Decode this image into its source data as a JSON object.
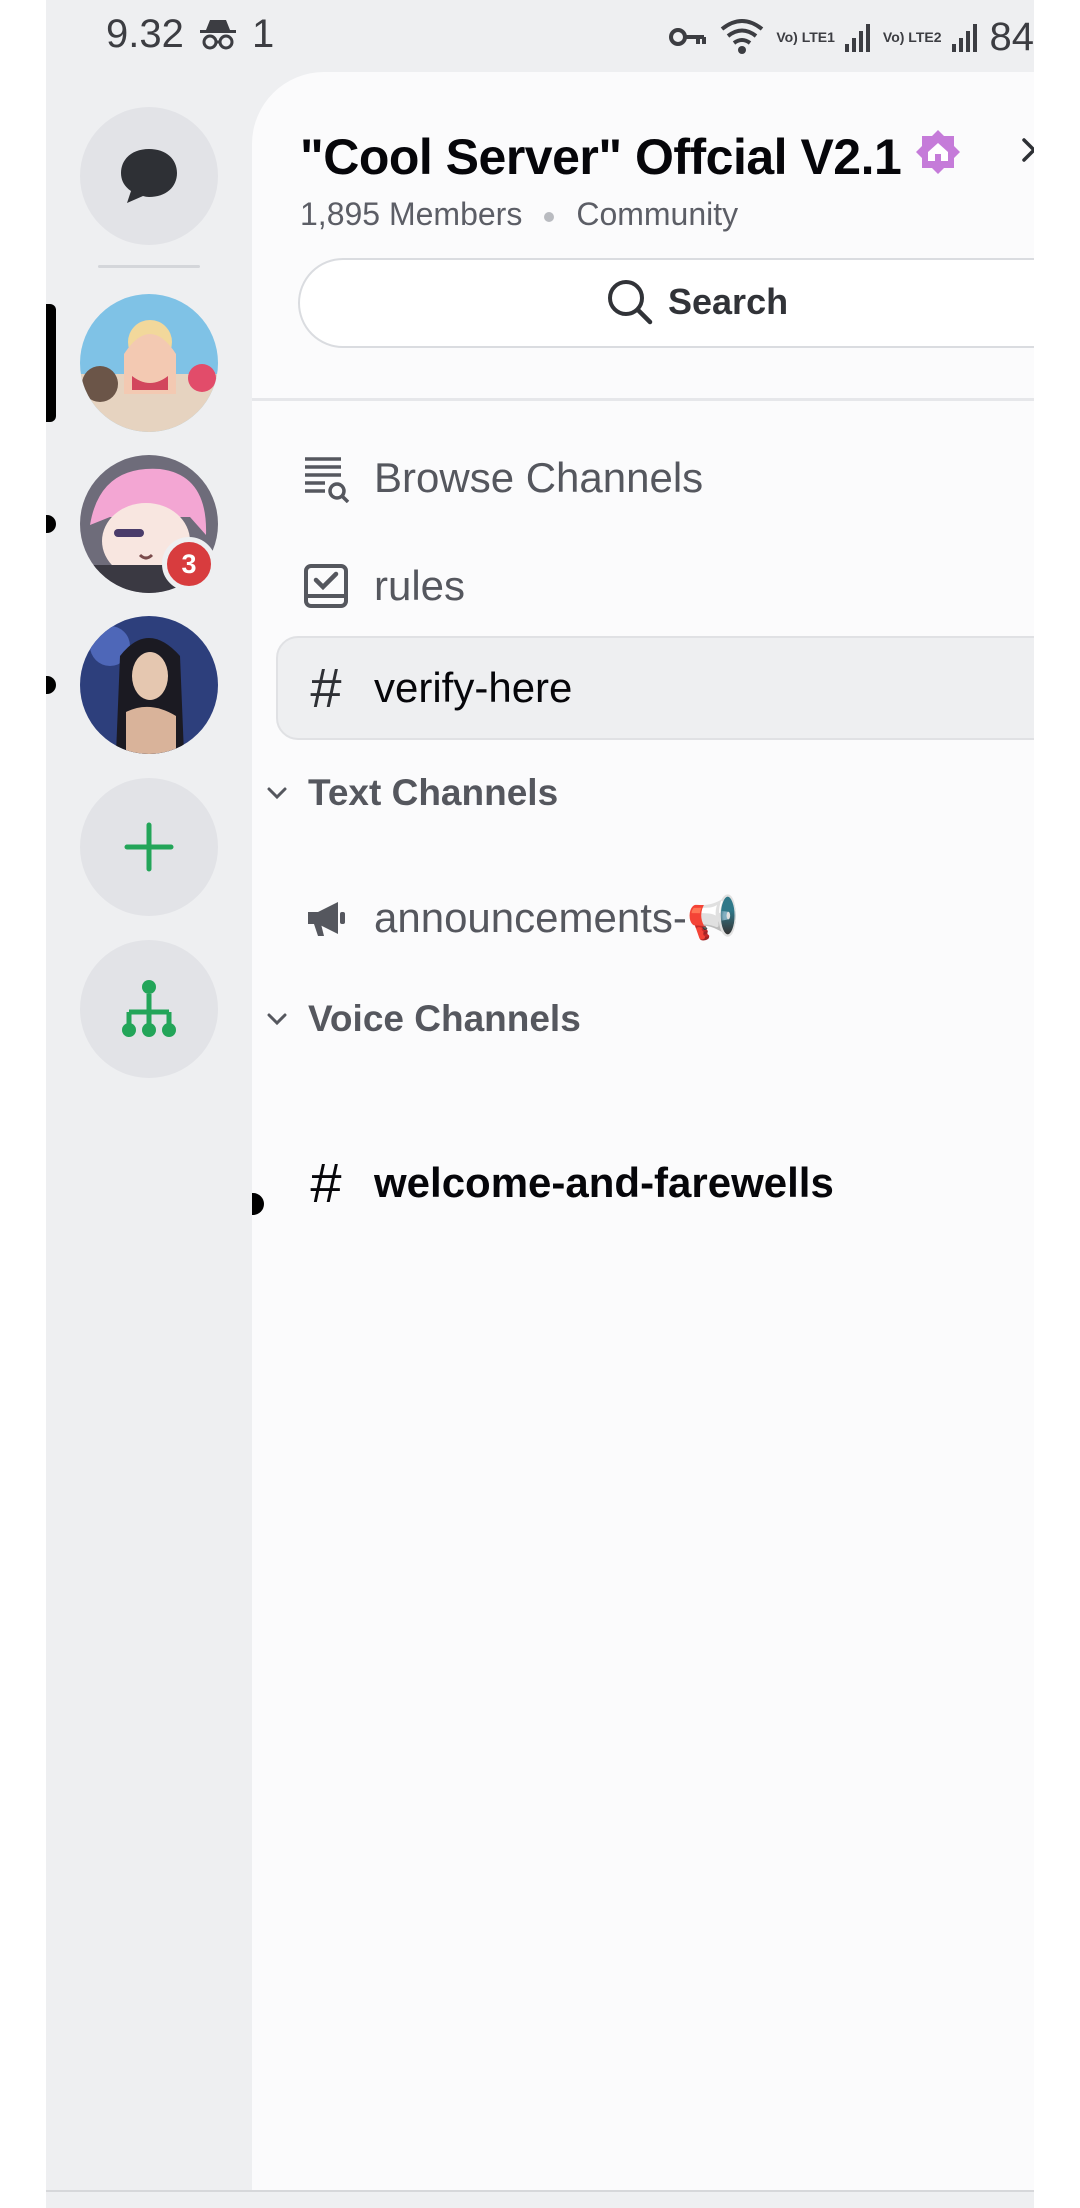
{
  "status_bar": {
    "time": "9.32",
    "notification_count": "1",
    "lte1": "Vo) LTE1",
    "lte2": "Vo) LTE2",
    "battery": "84"
  },
  "rail": {
    "badge_count": "3"
  },
  "server": {
    "name": "\"Cool Server\" Offcial V2.1",
    "members": "1,895 Members",
    "type": "Community"
  },
  "search": {
    "label": "Search"
  },
  "channels": {
    "browse_label": "Browse Channels",
    "rules_label": "rules",
    "verify_label": "verify-here",
    "text_category": "Text Channels",
    "announcements_label": "announcements-📢",
    "voice_category": "Voice Channels",
    "welcome_label": "welcome-and-farewells"
  },
  "colors": {
    "accent_green": "#23a559",
    "badge_red": "#d83c3e",
    "boost_purple": "#c57bd9"
  }
}
